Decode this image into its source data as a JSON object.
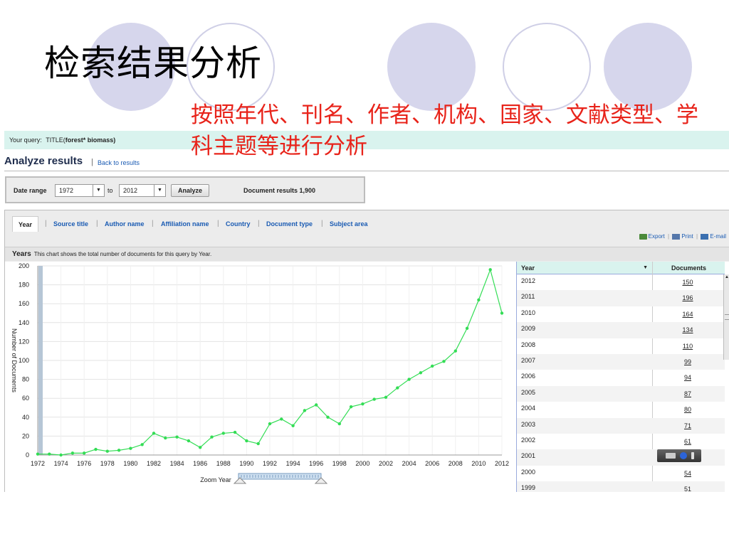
{
  "slide": {
    "title": "检索结果分析",
    "subtitle": "按照年代、刊名、作者、机构、国家、文献类型、学科主题等进行分析"
  },
  "query": {
    "prefix": "Your query:",
    "field": "TITLE(",
    "term": "forest* biomass",
    "suffix": ")"
  },
  "header": {
    "title": "Analyze results",
    "back_link": "Back to results"
  },
  "date_range": {
    "label": "Date range",
    "from": "1972",
    "to_label": "to",
    "to": "2012",
    "analyze_button": "Analyze",
    "results": "Document results 1,900"
  },
  "tabs": [
    {
      "label": "Year",
      "active": true
    },
    {
      "label": "Source title",
      "active": false
    },
    {
      "label": "Author name",
      "active": false
    },
    {
      "label": "Affiliation name",
      "active": false
    },
    {
      "label": "Country",
      "active": false
    },
    {
      "label": "Document type",
      "active": false
    },
    {
      "label": "Subject area",
      "active": false
    }
  ],
  "tools": {
    "export": "Export",
    "print": "Print",
    "email": "E-mail"
  },
  "years_bar": {
    "heading": "Years",
    "description": "This chart shows the total number of documents for this query by Year."
  },
  "zoom_label": "Zoom Year",
  "table": {
    "col_year": "Year",
    "col_docs": "Documents",
    "rows": [
      {
        "year": "2012",
        "docs": "150"
      },
      {
        "year": "2011",
        "docs": "196"
      },
      {
        "year": "2010",
        "docs": "164"
      },
      {
        "year": "2009",
        "docs": "134"
      },
      {
        "year": "2008",
        "docs": "110"
      },
      {
        "year": "2007",
        "docs": "99"
      },
      {
        "year": "2006",
        "docs": "94"
      },
      {
        "year": "2005",
        "docs": "87"
      },
      {
        "year": "2004",
        "docs": "80"
      },
      {
        "year": "2003",
        "docs": "71"
      },
      {
        "year": "2002",
        "docs": "61"
      },
      {
        "year": "2001",
        "docs": ""
      },
      {
        "year": "2000",
        "docs": "54"
      },
      {
        "year": "1999",
        "docs": "51"
      }
    ]
  },
  "colors": {
    "subtitle": "#e8231a",
    "line": "#33dd55",
    "link": "#1a5bb3",
    "query_bg": "#d9f3ee"
  },
  "chart_data": {
    "type": "line",
    "title": "",
    "xlabel": "",
    "ylabel": "Number of Documents",
    "ylim": [
      0,
      200
    ],
    "xlim": [
      1972,
      2012
    ],
    "x_ticks": [
      "1972",
      "1974",
      "1976",
      "1978",
      "1980",
      "1982",
      "1984",
      "1986",
      "1988",
      "1990",
      "1992",
      "1994",
      "1996",
      "1998",
      "2000",
      "2002",
      "2004",
      "2006",
      "2008",
      "2010",
      "2012"
    ],
    "y_ticks": [
      "0",
      "20",
      "40",
      "60",
      "80",
      "100",
      "120",
      "140",
      "160",
      "180",
      "200"
    ],
    "grid": true,
    "x": [
      1972,
      1973,
      1974,
      1975,
      1976,
      1977,
      1978,
      1979,
      1980,
      1981,
      1982,
      1983,
      1984,
      1985,
      1986,
      1987,
      1988,
      1989,
      1990,
      1991,
      1992,
      1993,
      1994,
      1995,
      1996,
      1997,
      1998,
      1999,
      2000,
      2001,
      2002,
      2003,
      2004,
      2005,
      2006,
      2007,
      2008,
      2009,
      2010,
      2011,
      2012
    ],
    "series": [
      {
        "values": [
          1,
          1,
          0,
          2,
          2,
          6,
          4,
          5,
          7,
          11,
          23,
          18,
          19,
          15,
          8,
          19,
          23,
          24,
          15,
          12,
          33,
          38,
          31,
          47,
          53,
          40,
          33,
          51,
          54,
          59,
          61,
          71,
          80,
          87,
          94,
          99,
          110,
          134,
          164,
          196,
          150
        ]
      }
    ]
  }
}
